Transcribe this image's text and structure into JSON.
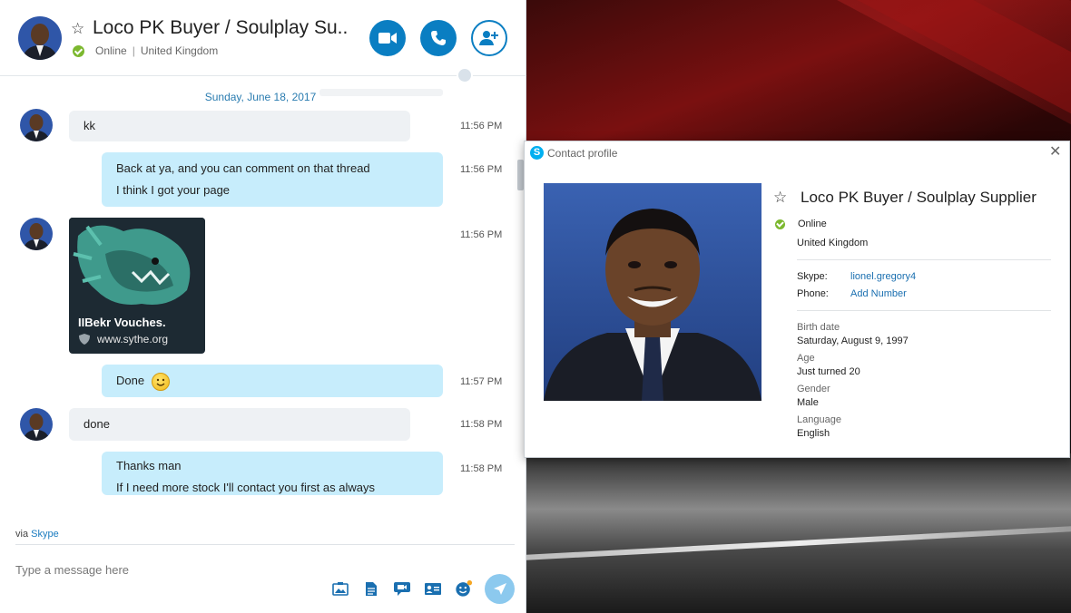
{
  "chat": {
    "contact_name": "Loco PK Buyer / Soulplay Su...",
    "status": "Online",
    "location": "United Kingdom",
    "date_separator": "Sunday, June 18, 2017",
    "messages": [
      {
        "direction": "in",
        "lines": [
          "kk"
        ],
        "time": "11:56 PM"
      },
      {
        "direction": "out",
        "lines": [
          "Back at ya, and you can comment on that thread",
          "I think I got your page"
        ],
        "time": "11:56 PM"
      },
      {
        "direction": "in",
        "type": "link",
        "card_title": "IIBekr Vouches.",
        "card_site": "www.sythe.org",
        "time": "11:56 PM"
      },
      {
        "direction": "out",
        "lines": [
          "Done"
        ],
        "emoji": "smiley",
        "time": "11:57 PM"
      },
      {
        "direction": "in",
        "lines": [
          "done"
        ],
        "time": "11:58 PM"
      },
      {
        "direction": "out",
        "lines": [
          "Thanks man",
          "If I need more stock I'll contact you first as always"
        ],
        "time": "11:58 PM"
      }
    ],
    "via_prefix": "via",
    "via_link": "Skype",
    "compose_placeholder": "Type a message here",
    "header_buttons": [
      "video-call-icon",
      "voice-call-icon",
      "add-people-icon"
    ],
    "toolbar_icons": [
      "send-photo-icon",
      "send-file-icon",
      "video-message-icon",
      "contact-card-icon",
      "emoticon-icon",
      "send-icon"
    ]
  },
  "profile": {
    "window_title": "Contact profile",
    "name": "Loco PK Buyer / Soulplay Supplier",
    "status": "Online",
    "country": "United Kingdom",
    "skype_label": "Skype:",
    "skype_value": "lionel.gregory4",
    "phone_label": "Phone:",
    "phone_value": "Add Number",
    "birth_label": "Birth date",
    "birth_value": "Saturday, August 9, 1997",
    "age_label": "Age",
    "age_value": "Just turned 20",
    "gender_label": "Gender",
    "gender_value": "Male",
    "language_label": "Language",
    "language_value": "English"
  },
  "colors": {
    "accent": "#0a7ec2",
    "online": "#7cb82f",
    "incoming_bubble": "#eef1f4",
    "outgoing_bubble": "#c7edfc"
  }
}
